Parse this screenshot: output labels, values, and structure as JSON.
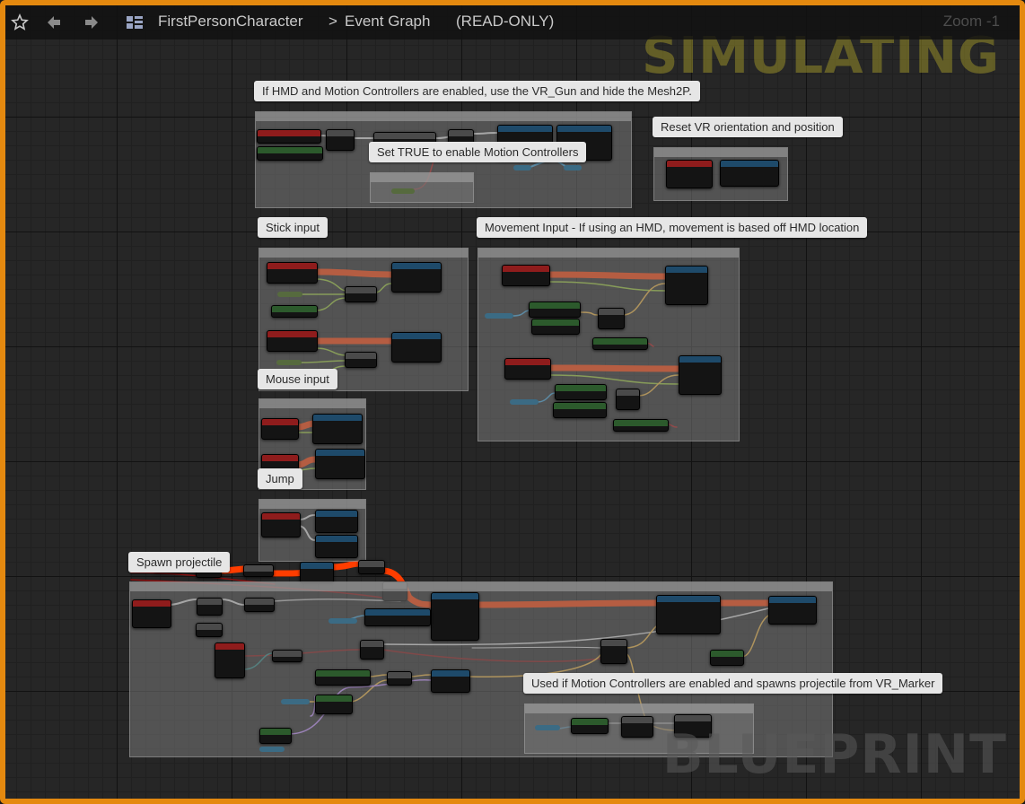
{
  "topbar": {
    "favorite_icon": "star-icon",
    "back_icon": "arrow-left-icon",
    "forward_icon": "arrow-right-icon",
    "graph_icon": "blueprint-graph-icon",
    "breadcrumb_root": "FirstPersonCharacter",
    "separator": ">",
    "breadcrumb_graph": "Event Graph",
    "mode": "(READ-ONLY)",
    "zoom": "Zoom -1"
  },
  "overlay": {
    "simulating": "SIMULATING",
    "watermark": "BLUEPRINT"
  },
  "comments": {
    "hmd": "If HMD and Motion Controllers are enabled, use the VR_Gun and hide the Mesh2P.",
    "set_true": "Set TRUE to enable Motion Controllers",
    "reset_vr": "Reset VR orientation and position",
    "stick_input": "Stick input",
    "movement_input": "Movement Input - If using an HMD, movement is based off HMD location",
    "mouse_input": "Mouse input",
    "jump": "Jump",
    "spawn_projectile": "Spawn projectile",
    "motion_controllers": "Used if Motion Controllers are enabled and spawns projectile from VR_Marker"
  },
  "colors": {
    "frame_border": "#e4890f",
    "exec_wire": "#ff3d00",
    "float_wire": "#9ac834",
    "vector_wire": "#f0b43c",
    "bool_wire": "#8a1010",
    "object_wire": "#3a9fd8",
    "transform_wire": "#c08cff"
  }
}
